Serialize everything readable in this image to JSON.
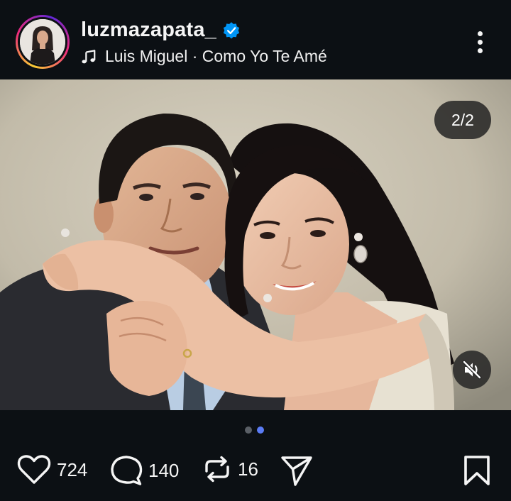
{
  "post": {
    "username": "luzmazapata_",
    "verified": true,
    "music": "Luis Miguel · Como Yo Te Amé",
    "more_icon": "more-vertical-icon"
  },
  "media": {
    "counter": "2/2",
    "current_index": 2,
    "total": 2,
    "mute_icon": "speaker-muted-icon",
    "description": "photo of a man in a dark suit and a woman embracing"
  },
  "pager": {
    "total": 2,
    "active": 2,
    "active_color": "#5b7cf5",
    "inactive_color": "#5a5f66"
  },
  "actions": {
    "likes": "724",
    "comments": "140",
    "reposts": "16",
    "like_icon": "heart-icon",
    "comment_icon": "comment-bubble-icon",
    "repost_icon": "repost-icon",
    "share_icon": "send-icon",
    "save_icon": "bookmark-icon"
  },
  "colors": {
    "background": "#0c1014",
    "text": "#f5f5f5",
    "verified_badge": "#0095f6"
  }
}
